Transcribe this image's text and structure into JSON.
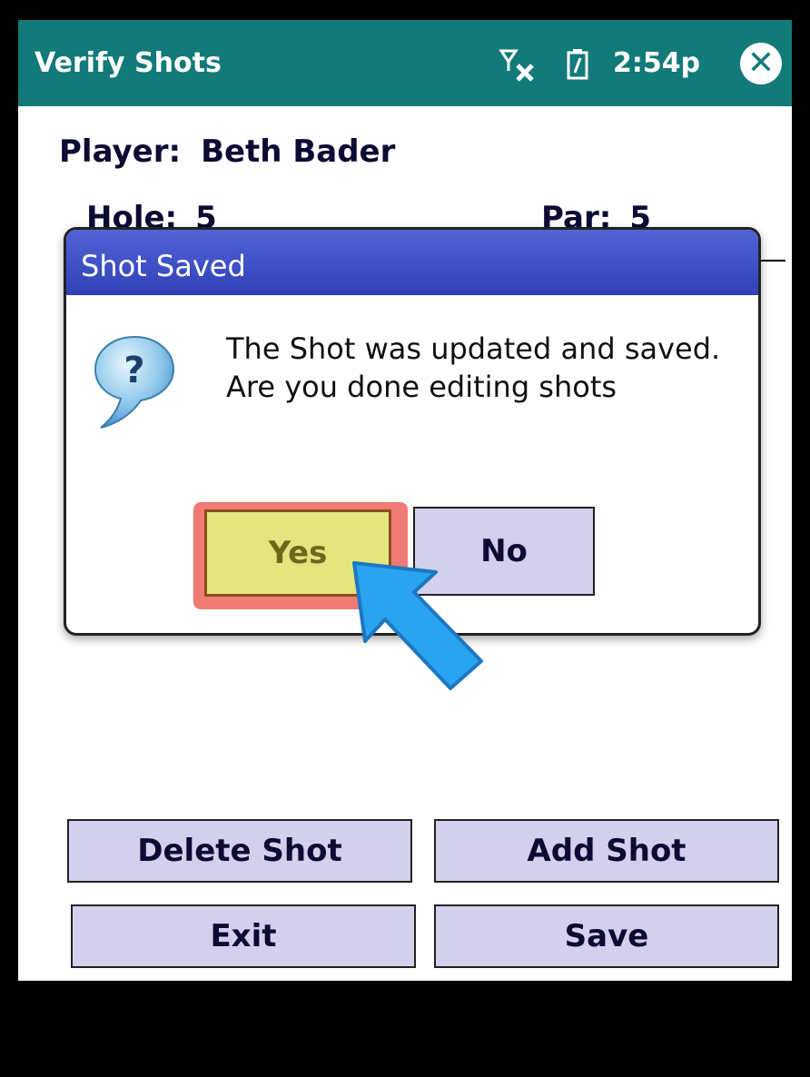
{
  "titlebar": {
    "title": "Verify Shots",
    "time": "2:54p",
    "icons": [
      "signal-off-icon",
      "battery-icon",
      "close-icon"
    ],
    "close_glyph": "✕"
  },
  "info": {
    "player_label": "Player:",
    "player_value": "Beth Bader",
    "hole_label": "Hole:",
    "hole_value": "5",
    "par_label": "Par:",
    "par_value": "5"
  },
  "dialog": {
    "title": "Shot Saved",
    "icon": "question-bubble-icon",
    "message": "The Shot was updated and saved. Are you done editing shots",
    "yes_label": "Yes",
    "no_label": "No"
  },
  "actions": {
    "delete_label": "Delete Shot",
    "add_label": "Add Shot",
    "exit_label": "Exit",
    "save_label": "Save"
  },
  "colors": {
    "titlebar": "#127a78",
    "dialog_header": "#3f4fc9",
    "button_fill": "#d2d0ec",
    "highlight": "#f07a74",
    "yes_fill": "#e4e57f",
    "pointer": "#2aa4f0"
  }
}
